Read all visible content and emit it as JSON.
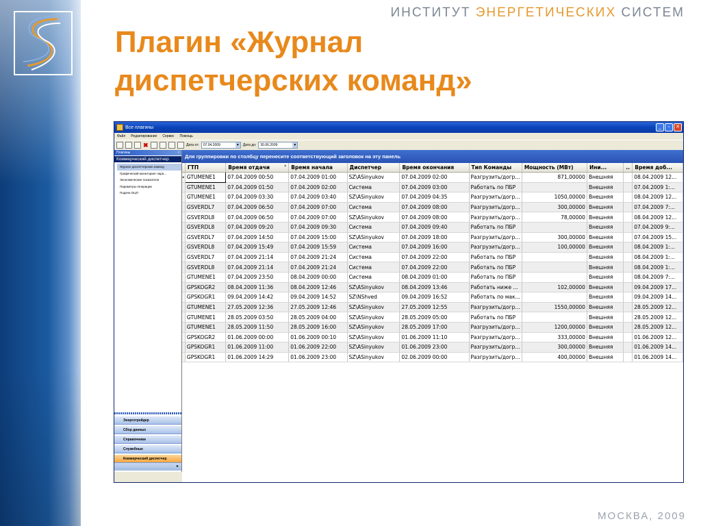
{
  "slide": {
    "org_prefix": "ИНСТИТУТ ",
    "org_accent": "ЭНЕРГЕТИЧЕСКИХ",
    "org_suffix": " СИСТЕМ",
    "title_line1": "Плагин «Журнал",
    "title_line2": "диспетчерских команд»",
    "footer": "МОСКВА, 2009",
    "colors": {
      "title": "#e8891c",
      "band": "#1b5aa0",
      "accent": "#e59a2f"
    }
  },
  "window": {
    "title": "Все плагины",
    "menu": [
      "Файл",
      "Редактирование",
      "Сервис",
      "Помощь"
    ],
    "toolbar": {
      "date_from_label": "Дата от:",
      "date_from": "07.04.2009",
      "date_to_label": "Дата до:",
      "date_to": "30.06.2009"
    }
  },
  "left_panel": {
    "header": "Плагины",
    "selected_plugin": "Коммерческий диспетчер",
    "tree": [
      "Журнал диспетчерских команд",
      "Графический мониторинг пара...",
      "Экономические показатели",
      "Параметры генерации",
      "Подача ОЦП"
    ],
    "nav_buttons": [
      "Энерготрейдер",
      "Сбор данных",
      "Справочники",
      "Служебные",
      "Коммерческий диспетчер"
    ],
    "active_nav": "Коммерческий диспетчер"
  },
  "grid": {
    "group_hint": "Для группировки по столбцу перенесите соответствующий заголовок на эту панель",
    "columns": [
      "ГТП",
      "Время отдачи",
      "Время начала",
      "Диспетчер",
      "Время окончания",
      "Тип Команды",
      "Мощность (МВт)",
      "Ини...",
      "..",
      "Время доб..."
    ],
    "rows": [
      [
        "GTUMENE1",
        "07.04.2009 00:50",
        "07.04.2009 01:00",
        "SZ\\ASinyukov",
        "07.04.2009 02:00",
        "Разгрузить/догр...",
        "871,00000",
        "Внешняя",
        "",
        "08.04.2009 12..."
      ],
      [
        "GTUMENE1",
        "07.04.2009 01:50",
        "07.04.2009 02:00",
        "Система",
        "07.04.2009 03:00",
        "Работать по ПБР",
        "",
        "Внешняя",
        "",
        "07.04.2009 1:..."
      ],
      [
        "GTUMENE1",
        "07.04.2009 03:30",
        "07.04.2009 03:40",
        "SZ\\ASinyukov",
        "07.04.2009 04:35",
        "Разгрузить/догр...",
        "1050,00000",
        "Внешняя",
        "",
        "08.04.2009 12..."
      ],
      [
        "GSVERDL7",
        "07.04.2009 06:50",
        "07.04.2009 07:00",
        "Система",
        "07.04.2009 08:00",
        "Разгрузить/догр...",
        "300,00000",
        "Внешняя",
        "",
        "07.04.2009 7:..."
      ],
      [
        "GSVERDL8",
        "07.04.2009 06:50",
        "07.04.2009 07:00",
        "SZ\\ASinyukov",
        "07.04.2009 08:00",
        "Разгрузить/догр...",
        "78,00000",
        "Внешняя",
        "",
        "08.04.2009 12..."
      ],
      [
        "GSVERDL8",
        "07.04.2009 09:20",
        "07.04.2009 09:30",
        "Система",
        "07.04.2009 09:40",
        "Работать по ПБР",
        "",
        "Внешняя",
        "",
        "07.04.2009 9:..."
      ],
      [
        "GSVERDL7",
        "07.04.2009 14:50",
        "07.04.2009 15:00",
        "SZ\\ASinyukov",
        "07.04.2009 18:00",
        "Разгрузить/догр...",
        "300,00000",
        "Внешняя",
        "",
        "07.04.2009 15..."
      ],
      [
        "GSVERDL8",
        "07.04.2009 15:49",
        "07.04.2009 15:59",
        "Система",
        "07.04.2009 16:00",
        "Разгрузить/догр...",
        "100,00000",
        "Внешняя",
        "",
        "08.04.2009 1:..."
      ],
      [
        "GSVERDL7",
        "07.04.2009 21:14",
        "07.04.2009 21:24",
        "Система",
        "07.04.2009 22:00",
        "Работать по ПБР",
        "",
        "Внешняя",
        "",
        "08.04.2009 1:..."
      ],
      [
        "GSVERDL8",
        "07.04.2009 21:14",
        "07.04.2009 21:24",
        "Система",
        "07.04.2009 22:00",
        "Работать по ПБР",
        "",
        "Внешняя",
        "",
        "08.04.2009 1:..."
      ],
      [
        "GTUMENE1",
        "07.04.2009 23:50",
        "08.04.2009 00:00",
        "Система",
        "08.04.2009 01:00",
        "Работать по ПБР",
        "",
        "Внешняя",
        "",
        "08.04.2009 7:..."
      ],
      [
        "GPSKOGR2",
        "08.04.2009 11:36",
        "08.04.2009 12:46",
        "SZ\\ASinyukov",
        "08.04.2009 13:46",
        "Работать ниже ...",
        "102,00000",
        "Внешняя",
        "",
        "09.04.2009 17..."
      ],
      [
        "GPSKOGR1",
        "09.04.2009 14:42",
        "09.04.2009 14:52",
        "SZ\\NShved",
        "09.04.2009 16:52",
        "Работать по мак...",
        "",
        "Внешняя",
        "",
        "09.04.2009 14..."
      ],
      [
        "GTUMENE1",
        "27.05.2009 12:36",
        "27.05.2009 12:46",
        "SZ\\ASinyukov",
        "27.05.2009 12:55",
        "Разгрузить/догр...",
        "1550,00000",
        "Внешняя",
        "",
        "28.05.2009 12..."
      ],
      [
        "GTUMENE1",
        "28.05.2009 03:50",
        "28.05.2009 04:00",
        "SZ\\ASinyukov",
        "28.05.2009 05:00",
        "Работать по ПБР",
        "",
        "Внешняя",
        "",
        "28.05.2009 12..."
      ],
      [
        "GTUMENE1",
        "28.05.2009 11:50",
        "28.05.2009 16:00",
        "SZ\\ASinyukov",
        "28.05.2009 17:00",
        "Разгрузить/догр...",
        "1200,00000",
        "Внешняя",
        "",
        "28.05.2009 12..."
      ],
      [
        "GPSKOGR2",
        "01.06.2009 00:00",
        "01.06.2009 00:10",
        "SZ\\ASinyukov",
        "01.06.2009 11:10",
        "Разгрузить/догр...",
        "333,00000",
        "Внешняя",
        "",
        "01.06.2009 12..."
      ],
      [
        "GPSKOGR1",
        "01.06.2009 11:00",
        "01.06.2009 22:00",
        "SZ\\ASinyukov",
        "01.06.2009 23:00",
        "Разгрузить/догр...",
        "300,00000",
        "Внешняя",
        "",
        "01.06.2009 14..."
      ],
      [
        "GPSKOGR1",
        "01.06.2009 14:29",
        "01.06.2009 23:00",
        "SZ\\ASinyukov",
        "02.06.2009 00:00",
        "Разгрузить/догр...",
        "400,00000",
        "Внешняя",
        "",
        "01.06.2009 14..."
      ]
    ]
  }
}
